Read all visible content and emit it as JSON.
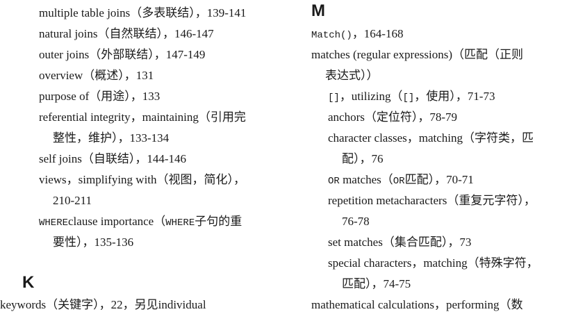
{
  "left_column": {
    "lines": [
      "multiple table joins（多表联结），139-141",
      "natural joins（自然联结），146-147",
      "outer joins（外部联结），147-149",
      "overview（概述），131",
      "purpose of（用途），133",
      "referential integrity，maintaining（引用完",
      "整性，维护），133-134",
      "self joins（自联结），144-146",
      "views，simplifying with（视图，简化），",
      "210-211",
      "clause importance（",
      "子句的重",
      "要性），135-136"
    ],
    "where_kw": "WHERE",
    "heading_k": "K",
    "keywords_line": "keywords（关键字），22，另见individual"
  },
  "right_column": {
    "heading_m": "M",
    "match_fn": "Match()",
    "match_pages": "，164-168",
    "lines": [
      "matches (regular expressions)（匹配（正则",
      "表达式））",
      "，utilizing（",
      "，使用），71-73",
      "anchors（定位符），78-79",
      "character classes，matching（字符类，匹",
      "配），76",
      " matches（",
      "匹配），70-71",
      "repetition metacharacters（重复元字符），",
      "76-78",
      "set matches（集合匹配），73",
      "special characters，matching（特殊字符，",
      "匹配），74-75",
      "mathematical calculations，performing（数"
    ],
    "brackets": "[]",
    "or_kw": "OR"
  }
}
